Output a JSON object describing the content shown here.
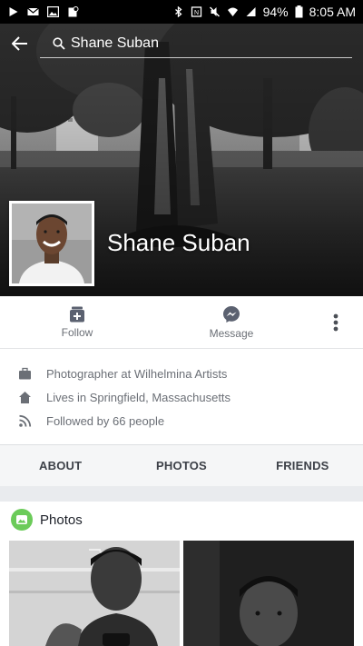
{
  "status_bar": {
    "battery": "94%",
    "time": "8:05 AM",
    "left_icons": [
      "play-icon",
      "mail-icon",
      "image-icon",
      "clipboard-icon"
    ],
    "right_icons": [
      "bluetooth-icon",
      "nfc-icon",
      "mute-icon",
      "wifi-icon",
      "signal-icon"
    ]
  },
  "header": {
    "search_text": "Shane Suban",
    "back_icon": "back-arrow-icon",
    "search_icon": "search-icon"
  },
  "profile": {
    "name": "Shane Suban"
  },
  "actions": {
    "follow_label": "Follow",
    "message_label": "Message",
    "more_icon": "more-vertical-icon"
  },
  "info": {
    "items": [
      {
        "icon": "briefcase-icon",
        "text": "Photographer at Wilhelmina Artists"
      },
      {
        "icon": "home-icon",
        "text": "Lives in Springfield, Massachusetts"
      },
      {
        "icon": "rss-icon",
        "text": "Followed by 66 people"
      }
    ]
  },
  "tabs": [
    "ABOUT",
    "PHOTOS",
    "FRIENDS"
  ],
  "photos": {
    "title": "Photos",
    "icon": "photos-icon"
  },
  "colors": {
    "accent": "#4267b2",
    "photos_icon_green": "#6bcb59",
    "text_muted": "#6b6f76",
    "page_bg": "#e9ebee"
  }
}
